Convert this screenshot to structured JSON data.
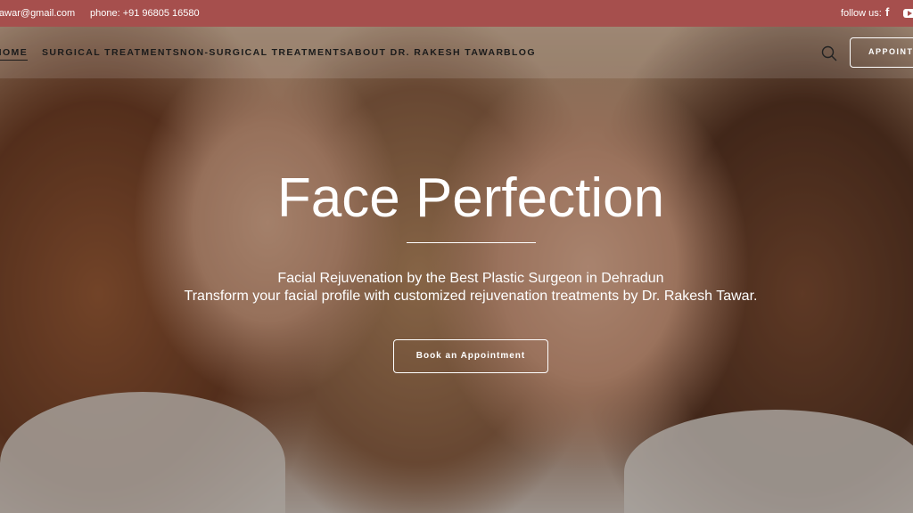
{
  "topbar": {
    "email": "tawar@gmail.com",
    "phone": "phone: +91 96805 16580",
    "follow_label": "follow us:",
    "facebook_glyph": "f",
    "background": "#a64f4d",
    "icons": [
      "facebook-icon",
      "youtube-icon"
    ]
  },
  "nav": {
    "items": [
      "HOME",
      "SURGICAL TREATMENTS",
      "NON-SURGICAL TREATMENTS",
      "ABOUT DR. RAKESH TAWAR",
      "BLOG"
    ],
    "appointment_label": "APPOINTMENT",
    "search_icon": "search-icon"
  },
  "hero": {
    "title": "Face Perfection",
    "subtitle_1": "Facial Rejuvenation by the Best Plastic Surgeon in Dehradun",
    "subtitle_2": "Transform your facial profile with customized rejuvenation treatments by Dr. Rakesh Tawar.",
    "button_label": "Book an Appointment"
  }
}
